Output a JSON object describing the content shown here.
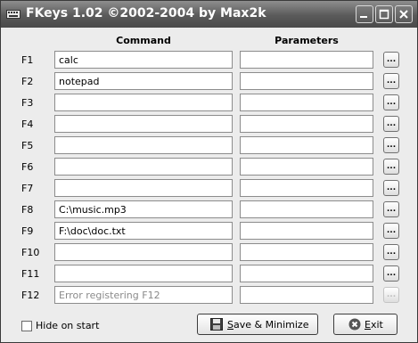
{
  "window": {
    "title": "FKeys 1.02 ©2002-2004 by Max2k",
    "app_icon": "keyboard-icon",
    "controls": [
      "minimize-icon",
      "maximize-icon",
      "close-icon"
    ]
  },
  "table": {
    "headers": {
      "command": "Command",
      "parameters": "Parameters"
    },
    "browse_label": "...",
    "rows": [
      {
        "key": "F1",
        "command": "calc",
        "parameters": ""
      },
      {
        "key": "F2",
        "command": "notepad",
        "parameters": ""
      },
      {
        "key": "F3",
        "command": "",
        "parameters": ""
      },
      {
        "key": "F4",
        "command": "",
        "parameters": ""
      },
      {
        "key": "F5",
        "command": "",
        "parameters": ""
      },
      {
        "key": "F6",
        "command": "",
        "parameters": ""
      },
      {
        "key": "F7",
        "command": "",
        "parameters": ""
      },
      {
        "key": "F8",
        "command": "C:\\music.mp3",
        "parameters": ""
      },
      {
        "key": "F9",
        "command": "F:\\doc\\doc.txt",
        "parameters": ""
      },
      {
        "key": "F10",
        "command": "",
        "parameters": ""
      },
      {
        "key": "F11",
        "command": "",
        "parameters": ""
      },
      {
        "key": "F12",
        "command": "Error registering F12",
        "parameters": "",
        "disabled": true
      }
    ]
  },
  "footer": {
    "hide_on_start": {
      "label": "Hide on start",
      "checked": false
    },
    "save_button": {
      "underline": "S",
      "rest": "ave & Minimize",
      "icon": "floppy-disk-icon"
    },
    "exit_button": {
      "underline": "E",
      "rest": "xit",
      "icon": "exit-icon"
    }
  }
}
